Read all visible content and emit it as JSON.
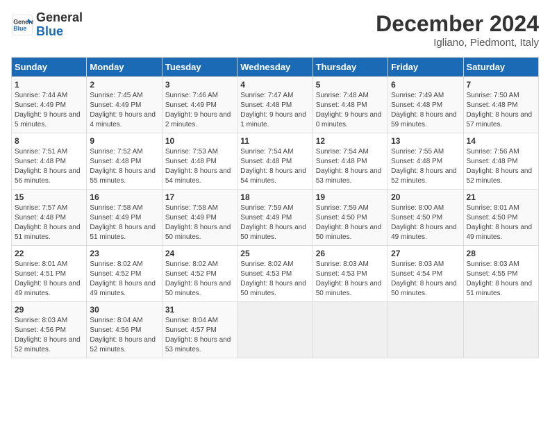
{
  "logo": {
    "line1": "General",
    "line2": "Blue"
  },
  "title": "December 2024",
  "subtitle": "Igliano, Piedmont, Italy",
  "days_header": [
    "Sunday",
    "Monday",
    "Tuesday",
    "Wednesday",
    "Thursday",
    "Friday",
    "Saturday"
  ],
  "weeks": [
    [
      {
        "num": "1",
        "rise": "7:44 AM",
        "set": "4:49 PM",
        "daylight": "9 hours and 5 minutes."
      },
      {
        "num": "2",
        "rise": "7:45 AM",
        "set": "4:49 PM",
        "daylight": "9 hours and 4 minutes."
      },
      {
        "num": "3",
        "rise": "7:46 AM",
        "set": "4:49 PM",
        "daylight": "9 hours and 2 minutes."
      },
      {
        "num": "4",
        "rise": "7:47 AM",
        "set": "4:48 PM",
        "daylight": "9 hours and 1 minute."
      },
      {
        "num": "5",
        "rise": "7:48 AM",
        "set": "4:48 PM",
        "daylight": "9 hours and 0 minutes."
      },
      {
        "num": "6",
        "rise": "7:49 AM",
        "set": "4:48 PM",
        "daylight": "8 hours and 59 minutes."
      },
      {
        "num": "7",
        "rise": "7:50 AM",
        "set": "4:48 PM",
        "daylight": "8 hours and 57 minutes."
      }
    ],
    [
      {
        "num": "8",
        "rise": "7:51 AM",
        "set": "4:48 PM",
        "daylight": "8 hours and 56 minutes."
      },
      {
        "num": "9",
        "rise": "7:52 AM",
        "set": "4:48 PM",
        "daylight": "8 hours and 55 minutes."
      },
      {
        "num": "10",
        "rise": "7:53 AM",
        "set": "4:48 PM",
        "daylight": "8 hours and 54 minutes."
      },
      {
        "num": "11",
        "rise": "7:54 AM",
        "set": "4:48 PM",
        "daylight": "8 hours and 54 minutes."
      },
      {
        "num": "12",
        "rise": "7:54 AM",
        "set": "4:48 PM",
        "daylight": "8 hours and 53 minutes."
      },
      {
        "num": "13",
        "rise": "7:55 AM",
        "set": "4:48 PM",
        "daylight": "8 hours and 52 minutes."
      },
      {
        "num": "14",
        "rise": "7:56 AM",
        "set": "4:48 PM",
        "daylight": "8 hours and 52 minutes."
      }
    ],
    [
      {
        "num": "15",
        "rise": "7:57 AM",
        "set": "4:48 PM",
        "daylight": "8 hours and 51 minutes."
      },
      {
        "num": "16",
        "rise": "7:58 AM",
        "set": "4:49 PM",
        "daylight": "8 hours and 51 minutes."
      },
      {
        "num": "17",
        "rise": "7:58 AM",
        "set": "4:49 PM",
        "daylight": "8 hours and 50 minutes."
      },
      {
        "num": "18",
        "rise": "7:59 AM",
        "set": "4:49 PM",
        "daylight": "8 hours and 50 minutes."
      },
      {
        "num": "19",
        "rise": "7:59 AM",
        "set": "4:50 PM",
        "daylight": "8 hours and 50 minutes."
      },
      {
        "num": "20",
        "rise": "8:00 AM",
        "set": "4:50 PM",
        "daylight": "8 hours and 49 minutes."
      },
      {
        "num": "21",
        "rise": "8:01 AM",
        "set": "4:50 PM",
        "daylight": "8 hours and 49 minutes."
      }
    ],
    [
      {
        "num": "22",
        "rise": "8:01 AM",
        "set": "4:51 PM",
        "daylight": "8 hours and 49 minutes."
      },
      {
        "num": "23",
        "rise": "8:02 AM",
        "set": "4:52 PM",
        "daylight": "8 hours and 49 minutes."
      },
      {
        "num": "24",
        "rise": "8:02 AM",
        "set": "4:52 PM",
        "daylight": "8 hours and 50 minutes."
      },
      {
        "num": "25",
        "rise": "8:02 AM",
        "set": "4:53 PM",
        "daylight": "8 hours and 50 minutes."
      },
      {
        "num": "26",
        "rise": "8:03 AM",
        "set": "4:53 PM",
        "daylight": "8 hours and 50 minutes."
      },
      {
        "num": "27",
        "rise": "8:03 AM",
        "set": "4:54 PM",
        "daylight": "8 hours and 50 minutes."
      },
      {
        "num": "28",
        "rise": "8:03 AM",
        "set": "4:55 PM",
        "daylight": "8 hours and 51 minutes."
      }
    ],
    [
      {
        "num": "29",
        "rise": "8:03 AM",
        "set": "4:56 PM",
        "daylight": "8 hours and 52 minutes."
      },
      {
        "num": "30",
        "rise": "8:04 AM",
        "set": "4:56 PM",
        "daylight": "8 hours and 52 minutes."
      },
      {
        "num": "31",
        "rise": "8:04 AM",
        "set": "4:57 PM",
        "daylight": "8 hours and 53 minutes."
      },
      null,
      null,
      null,
      null
    ]
  ]
}
